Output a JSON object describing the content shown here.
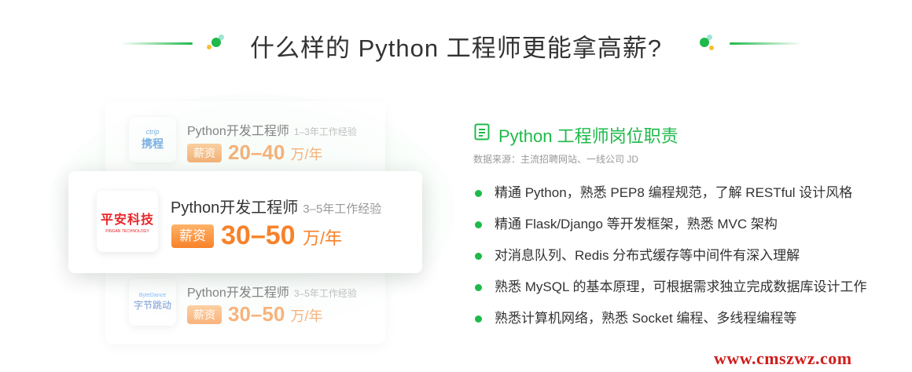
{
  "header": {
    "title": "什么样的 Python 工程师更能拿高薪?"
  },
  "cards": {
    "ctrip": {
      "logo_top": "ctrip",
      "logo_main": "携程",
      "title": "Python开发工程师",
      "experience": "1–3年工作经验",
      "badge": "薪资",
      "salary": "20–40",
      "unit": "万/年"
    },
    "pingan": {
      "logo_main": "平安科技",
      "logo_sub": "PINGAN TECHNOLOGY",
      "title": "Python开发工程师",
      "experience": "3–5年工作经验",
      "badge": "薪资",
      "salary": "30–50",
      "unit": "万/年"
    },
    "bytedance": {
      "logo_top": "ByteDance",
      "logo_main": "字节跳动",
      "title": "Python开发工程师",
      "experience": "3–5年工作经验",
      "badge": "薪资",
      "salary": "30–50",
      "unit": "万/年"
    }
  },
  "duties": {
    "title": "Python 工程师岗位职责",
    "source": "数据来源：主流招聘网站、一线公司 JD",
    "items": [
      "精通 Python，熟悉 PEP8 编程规范，了解 RESTful 设计风格",
      "精通 Flask/Django 等开发框架，熟悉 MVC 架构",
      "对消息队列、Redis 分布式缓存等中间件有深入理解",
      "熟悉 MySQL 的基本原理，可根据需求独立完成数据库设计工作",
      "熟悉计算机网络，熟悉 Socket 编程、多线程编程等"
    ]
  },
  "watermark": "www.cmszwz.com",
  "colors": {
    "accent": "#1fb94a",
    "salary": "#f7822a",
    "pingan_red": "#e8262a"
  },
  "icons": [
    "list-doc-icon",
    "bullet-dot-icon"
  ]
}
